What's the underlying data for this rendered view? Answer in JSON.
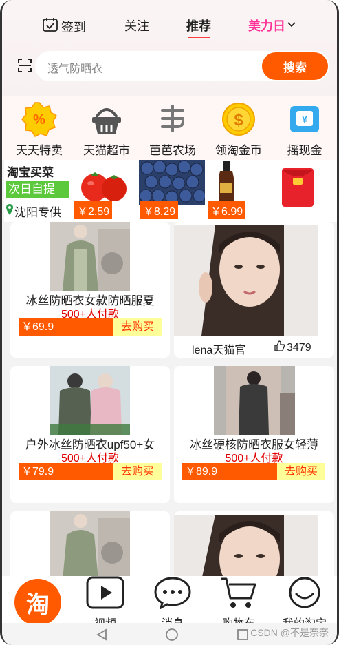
{
  "header": {
    "tabs": {
      "sign_in": "签到",
      "follow": "关注",
      "recommend": "推荐",
      "meili": "美力日"
    },
    "search": {
      "placeholder": "透气防晒衣",
      "button": "搜索"
    }
  },
  "shortcuts": [
    {
      "label": "天天特卖",
      "icon": "percent-badge-icon"
    },
    {
      "label": "天猫超市",
      "icon": "shopping-basket-icon"
    },
    {
      "label": "芭芭农场",
      "icon": "farm-icon"
    },
    {
      "label": "领淘金币",
      "icon": "gold-coin-icon"
    },
    {
      "label": "摇现金",
      "icon": "cash-icon"
    }
  ],
  "grocery": {
    "title": "淘宝买菜",
    "badge": "次日自提",
    "location": "沈阳专供",
    "items": [
      {
        "price": "￥2.59",
        "icon": "tomato-icon"
      },
      {
        "price": "￥8.29",
        "icon": "blueberry-icon"
      },
      {
        "price": "￥6.99",
        "icon": "soy-sauce-icon"
      },
      {
        "price": "",
        "icon": "red-envelope-icon"
      }
    ]
  },
  "products": [
    {
      "title": "冰丝防晒衣女款防晒服夏",
      "sold": "500+人付款",
      "price": "￥69.9",
      "buy": "去购买"
    },
    {
      "author": "lena天猫官",
      "likes": "3479"
    },
    {
      "title": "户外冰丝防晒衣upf50+女",
      "sold": "500+人付款",
      "price": "￥79.9",
      "buy": "去购买"
    },
    {
      "title": "冰丝硬核防晒衣服女轻薄",
      "sold": "500+人付款",
      "price": "￥89.9",
      "buy": "去购买"
    }
  ],
  "bottom_nav": {
    "home": "淘",
    "video": "视频",
    "messages": "消息",
    "cart": "购物车",
    "mine": "我的淘宝"
  },
  "watermark": "CSDN @不是奈奈",
  "colors": {
    "accent": "#ff5a00",
    "meili": "#ff3399",
    "sold": "#e00000"
  }
}
